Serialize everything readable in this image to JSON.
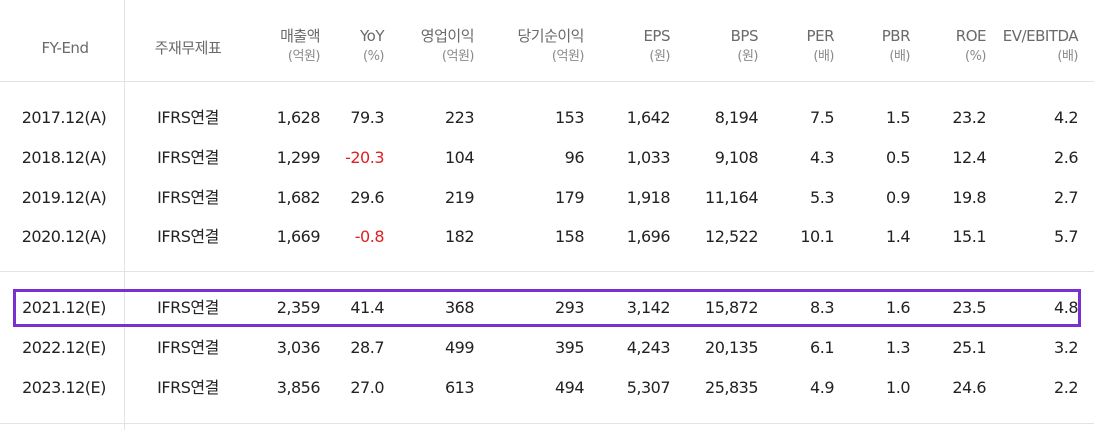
{
  "table": {
    "headers": [
      {
        "line1": "FY-End",
        "line2": ""
      },
      {
        "line1": "주재무제표",
        "line2": ""
      },
      {
        "line1": "매출액",
        "line2": "(억원)"
      },
      {
        "line1": "YoY",
        "line2": "(%)"
      },
      {
        "line1": "영업이익",
        "line2": "(억원)"
      },
      {
        "line1": "당기순이익",
        "line2": "(억원)"
      },
      {
        "line1": "EPS",
        "line2": "(원)"
      },
      {
        "line1": "BPS",
        "line2": "(원)"
      },
      {
        "line1": "PER",
        "line2": "(배)"
      },
      {
        "line1": "PBR",
        "line2": "(배)"
      },
      {
        "line1": "ROE",
        "line2": "(%)"
      },
      {
        "line1": "EV/EBITDA",
        "line2": "(배)"
      }
    ],
    "rows": [
      [
        "2017.12(A)",
        "IFRS연결",
        "1,628",
        "79.3",
        "223",
        "153",
        "1,642",
        "8,194",
        "7.5",
        "1.5",
        "23.2",
        "4.2"
      ],
      [
        "2018.12(A)",
        "IFRS연결",
        "1,299",
        "-20.3",
        "104",
        "96",
        "1,033",
        "9,108",
        "4.3",
        "0.5",
        "12.4",
        "2.6"
      ],
      [
        "2019.12(A)",
        "IFRS연결",
        "1,682",
        "29.6",
        "219",
        "179",
        "1,918",
        "11,164",
        "5.3",
        "0.9",
        "19.8",
        "2.7"
      ],
      [
        "2020.12(A)",
        "IFRS연결",
        "1,669",
        "-0.8",
        "182",
        "158",
        "1,696",
        "12,522",
        "10.1",
        "1.4",
        "15.1",
        "5.7"
      ],
      [
        "2021.12(E)",
        "IFRS연결",
        "2,359",
        "41.4",
        "368",
        "293",
        "3,142",
        "15,872",
        "8.3",
        "1.6",
        "23.5",
        "4.8"
      ],
      [
        "2022.12(E)",
        "IFRS연결",
        "3,036",
        "28.7",
        "499",
        "395",
        "4,243",
        "20,135",
        "6.1",
        "1.3",
        "25.1",
        "3.2"
      ],
      [
        "2023.12(E)",
        "IFRS연결",
        "3,856",
        "27.0",
        "613",
        "494",
        "5,307",
        "25,835",
        "4.9",
        "1.0",
        "24.6",
        "2.2"
      ]
    ],
    "negative_color": "#e02020",
    "highlight_color": "#7a2fd0"
  }
}
